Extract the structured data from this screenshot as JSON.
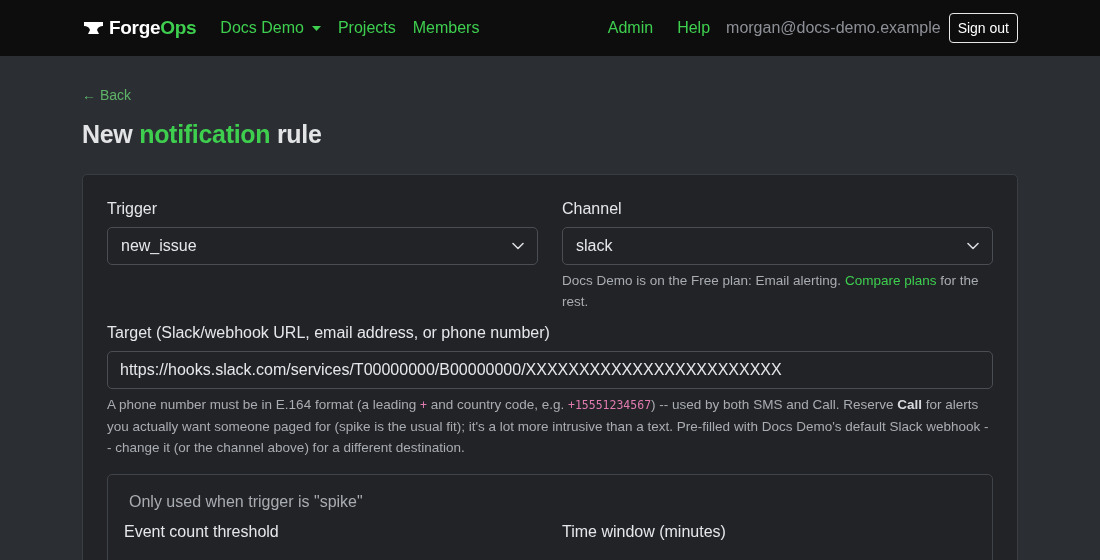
{
  "navbar": {
    "brand": {
      "part_1": "Forge",
      "part_2": "Ops"
    },
    "nav_links": [
      {
        "label": "Docs Demo",
        "kind": "dropdown"
      },
      {
        "label": "Projects",
        "kind": "link"
      },
      {
        "label": "Members",
        "kind": "link"
      }
    ],
    "right_links": [
      {
        "label": "Admin"
      },
      {
        "label": "Help"
      }
    ],
    "user_email": "morgan@docs-demo.example",
    "sign_out": "Sign out"
  },
  "back_link": "← Back",
  "heading": {
    "before": "New",
    "highlight": "notification",
    "after": "rule"
  },
  "form": {
    "trigger": {
      "label": "Trigger",
      "value": "new_issue"
    },
    "channel": {
      "label": "Channel",
      "value": "slack",
      "help": "Docs Demo is on the Free plan: Email alerting.",
      "help_link": "Compare plans",
      "help_after": "for the rest."
    },
    "target": {
      "label": "Target (Slack/webhook URL, email address, or phone number)",
      "value": "https://hooks.slack.com/services/T00000000/B00000000/XXXXXXXXXXXXXXXXXXXXXXXX",
      "help": [
        {
          "kind": "text",
          "text": "A phone number must be in E.164 format (a leading "
        },
        {
          "kind": "code",
          "text": "+"
        },
        {
          "kind": "text",
          "text": " and country code, e.g. "
        },
        {
          "kind": "code",
          "text": "+15551234567"
        },
        {
          "kind": "text",
          "text": ") -- used by both SMS and Call. Reserve "
        },
        {
          "kind": "bold",
          "text": "Call"
        },
        {
          "kind": "text",
          "text": " for alerts you actually want someone paged for (spike is the usual fit); it's a lot more intrusive than a text. Pre-filled with Docs Demo's default Slack webhook -- change it (or the channel above) for a different destination."
        }
      ]
    },
    "spike_section": {
      "legend": "Only used when trigger is \"spike\"",
      "fields": [
        {
          "label": "Event count threshold"
        },
        {
          "label": "Time window (minutes)"
        }
      ]
    }
  }
}
